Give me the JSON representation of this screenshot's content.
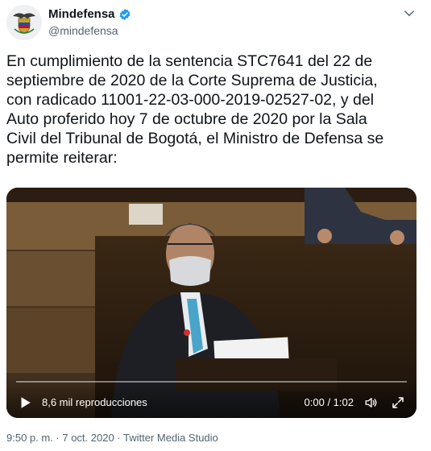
{
  "account": {
    "display_name": "Mindefensa",
    "handle": "@mindefensa",
    "verified": true
  },
  "tweet": {
    "lines": [
      "En cumplimiento de la sentencia STC7641 del 22 de",
      "septiembre de 2020 de la Corte Suprema de Justicia,",
      "con radicado 11001-22-03-000-2019-02527-02, y del",
      "Auto proferido hoy 7 de octubre de 2020 por la Sala",
      "Civil del Tribunal de Bogotá, el Ministro de Defensa se",
      "permite reiterar:"
    ]
  },
  "video": {
    "views": "8,6 mil reproducciones",
    "time": "0:00 / 1:02"
  },
  "footer": {
    "meta": "9:50 p. m. · 7 oct. 2020 · Twitter Media Studio"
  },
  "icons": {
    "verified": "verified-badge-icon",
    "more": "chevron-down-icon",
    "play": "play-icon",
    "volume": "volume-icon",
    "fullscreen": "fullscreen-icon"
  }
}
